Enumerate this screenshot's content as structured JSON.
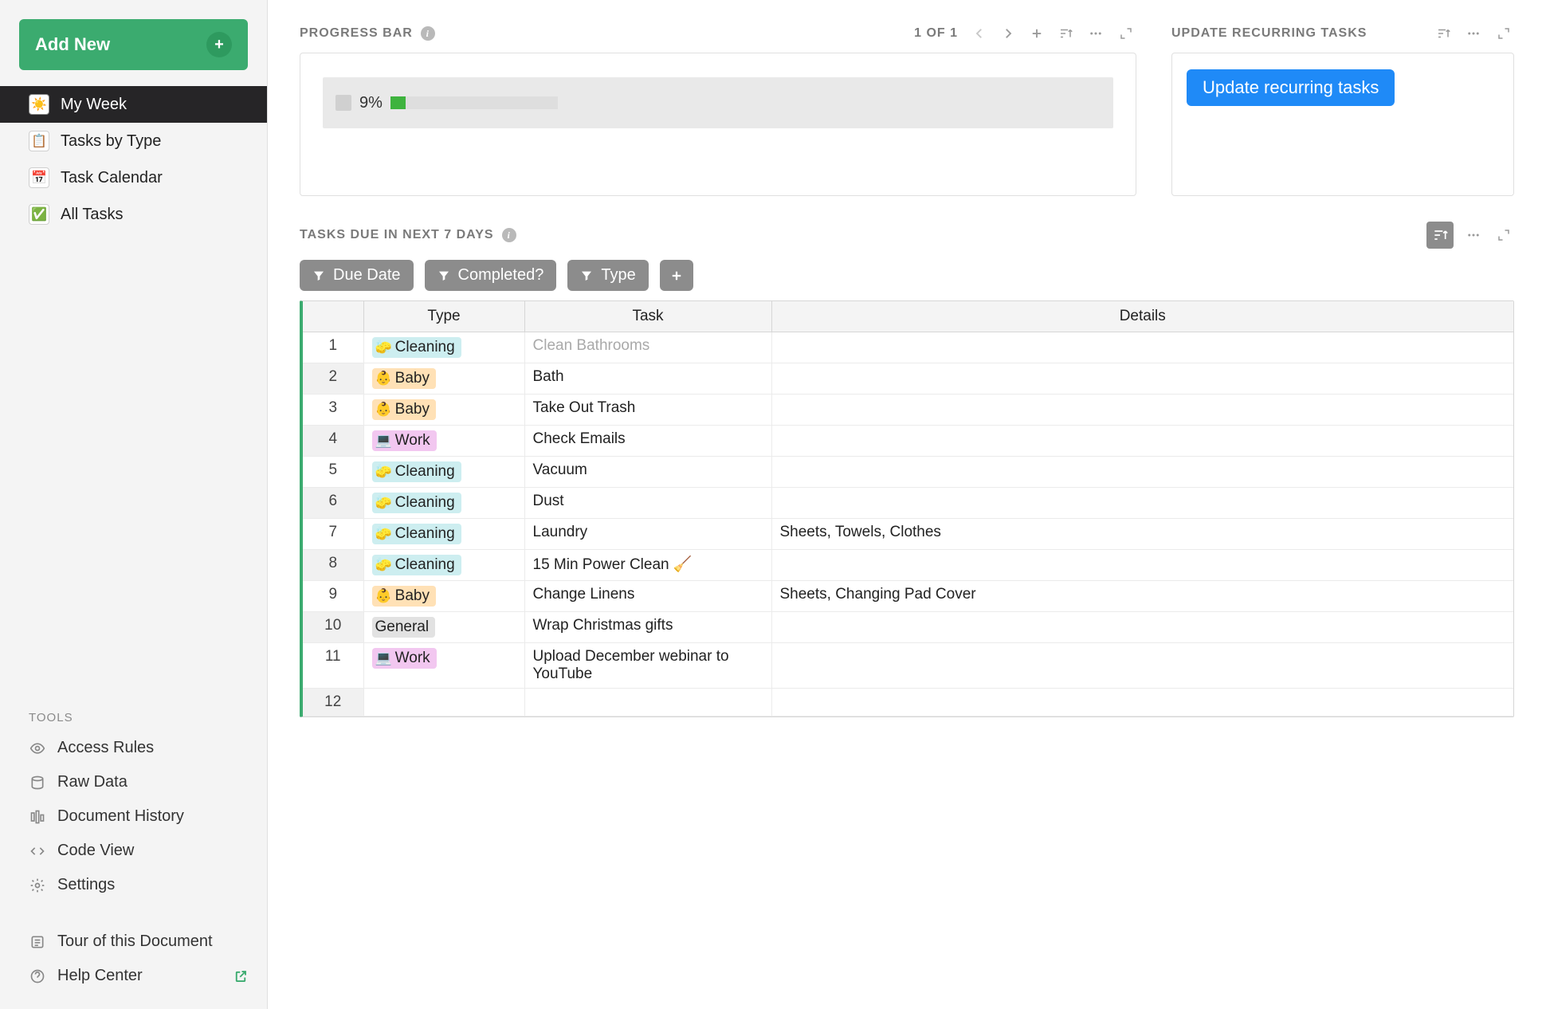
{
  "sidebar": {
    "add_new_label": "Add New",
    "nav": [
      {
        "label": "My Week",
        "icon": "☀️",
        "active": true
      },
      {
        "label": "Tasks by Type",
        "icon": "📋",
        "active": false
      },
      {
        "label": "Task Calendar",
        "icon": "📅",
        "active": false
      },
      {
        "label": "All Tasks",
        "icon": "✅",
        "active": false
      }
    ],
    "tools_title": "TOOLS",
    "tools": [
      {
        "label": "Access Rules",
        "icon": "eye"
      },
      {
        "label": "Raw Data",
        "icon": "db"
      },
      {
        "label": "Document History",
        "icon": "history"
      },
      {
        "label": "Code View",
        "icon": "code"
      },
      {
        "label": "Settings",
        "icon": "gear"
      }
    ],
    "footer": [
      {
        "label": "Tour of this Document",
        "icon": "tour",
        "external": false
      },
      {
        "label": "Help Center",
        "icon": "help",
        "external": true
      }
    ]
  },
  "progress": {
    "title": "PROGRESS BAR",
    "count_text": "1 OF 1",
    "percent_label": "9%",
    "percent_value": 9
  },
  "recurring": {
    "title": "UPDATE RECURRING TASKS",
    "button_label": "Update recurring tasks"
  },
  "tasks_panel": {
    "title": "TASKS DUE IN NEXT 7 DAYS",
    "filters": [
      "Due Date",
      "Completed?",
      "Type"
    ],
    "columns": [
      "Type",
      "Task",
      "Details"
    ],
    "type_styles": {
      "Cleaning": {
        "class": "tag-cleaning",
        "emoji": "🧽"
      },
      "Baby": {
        "class": "tag-baby",
        "emoji": "👶"
      },
      "Work": {
        "class": "tag-work",
        "emoji": "💻"
      },
      "General": {
        "class": "tag-general",
        "emoji": ""
      }
    },
    "rows": [
      {
        "n": 1,
        "type": "Cleaning",
        "task": "Clean Bathrooms",
        "details": "",
        "muted": true
      },
      {
        "n": 2,
        "type": "Baby",
        "task": "Bath",
        "details": ""
      },
      {
        "n": 3,
        "type": "Baby",
        "task": "Take Out Trash",
        "details": ""
      },
      {
        "n": 4,
        "type": "Work",
        "task": "Check Emails",
        "details": ""
      },
      {
        "n": 5,
        "type": "Cleaning",
        "task": "Vacuum",
        "details": ""
      },
      {
        "n": 6,
        "type": "Cleaning",
        "task": "Dust",
        "details": ""
      },
      {
        "n": 7,
        "type": "Cleaning",
        "task": "Laundry",
        "details": "Sheets, Towels, Clothes"
      },
      {
        "n": 8,
        "type": "Cleaning",
        "task": "15 Min Power Clean 🧹",
        "details": ""
      },
      {
        "n": 9,
        "type": "Baby",
        "task": "Change Linens",
        "details": "Sheets, Changing Pad Cover"
      },
      {
        "n": 10,
        "type": "General",
        "task": "Wrap Christmas gifts",
        "details": ""
      },
      {
        "n": 11,
        "type": "Work",
        "task": "Upload December webinar to YouTube",
        "details": ""
      },
      {
        "n": 12,
        "type": "",
        "task": "",
        "details": ""
      }
    ]
  }
}
